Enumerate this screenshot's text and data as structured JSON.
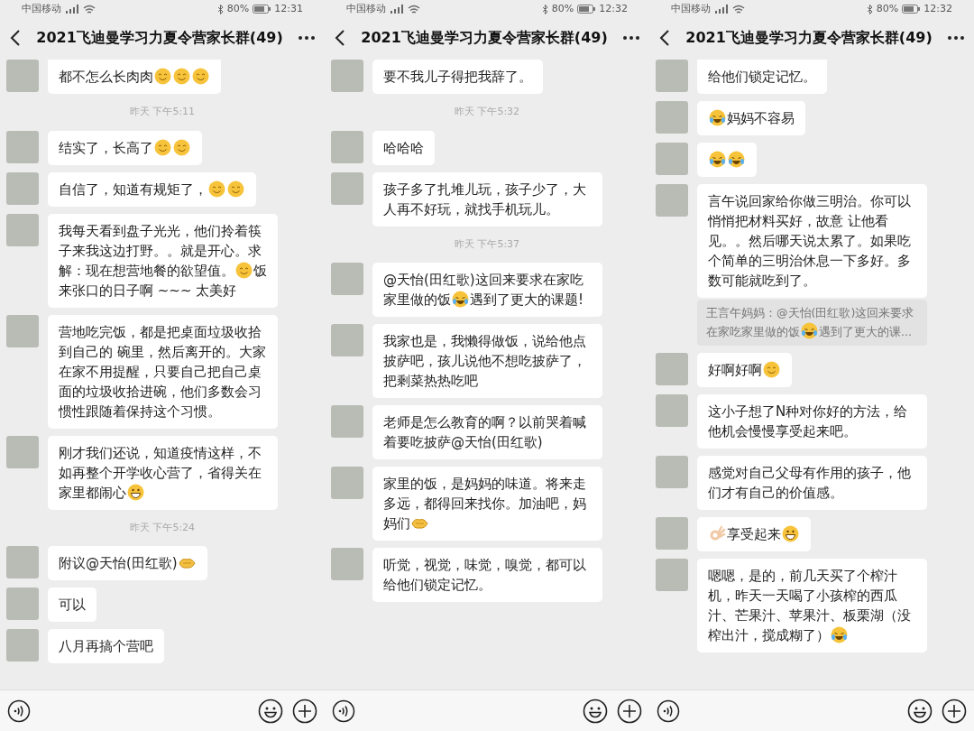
{
  "panels": [
    {
      "status_bar": {
        "carrier": "中国移动",
        "battery": "80%",
        "time": "12:31"
      },
      "title": "2021飞迪曼学习力夏令营家长群(49)",
      "messages": [
        {
          "kind": "msg",
          "cut": true,
          "parts": [
            {
              "kind": "text",
              "text": "都不怎么长肉肉"
            },
            {
              "kind": "smile"
            },
            {
              "kind": "smile"
            },
            {
              "kind": "smile"
            }
          ]
        },
        {
          "kind": "time",
          "text": "昨天 下午5:11"
        },
        {
          "kind": "msg",
          "parts": [
            {
              "kind": "text",
              "text": "结实了，长高了"
            },
            {
              "kind": "smile"
            },
            {
              "kind": "smile"
            }
          ]
        },
        {
          "kind": "msg",
          "parts": [
            {
              "kind": "text",
              "text": "自信了，知道有规矩了，"
            },
            {
              "kind": "smile"
            },
            {
              "kind": "smile"
            }
          ]
        },
        {
          "kind": "msg",
          "parts": [
            {
              "kind": "text",
              "text": "我每天看到盘子光光，他们拎着筷子来我这边打野。。就是开心。求解：现在想营地餐的欲望值。"
            },
            {
              "kind": "smile"
            },
            {
              "kind": "text",
              "text": "饭来张口的日子啊 ~~~ 太美好"
            }
          ]
        },
        {
          "kind": "msg",
          "parts": [
            {
              "kind": "text",
              "text": "营地吃完饭，都是把桌面垃圾收拾到自己的 碗里，然后离开的。大家在家不用提醒，只要自己把自己桌面的垃圾收拾进碗，他们多数会习惯性跟随着保持这个习惯。"
            }
          ]
        },
        {
          "kind": "msg",
          "parts": [
            {
              "kind": "text",
              "text": "刚才我们还说，知道疫情这样，不如再整个开学收心营了，省得关在家里都闹心"
            },
            {
              "kind": "grin"
            }
          ]
        },
        {
          "kind": "time",
          "text": "昨天 下午5:24"
        },
        {
          "kind": "msg",
          "parts": [
            {
              "kind": "text",
              "text": "附议@天怡(田红歌)"
            },
            {
              "kind": "handshake"
            }
          ]
        },
        {
          "kind": "msg",
          "parts": [
            {
              "kind": "text",
              "text": "可以"
            }
          ]
        },
        {
          "kind": "msg",
          "parts": [
            {
              "kind": "text",
              "text": "八月再搞个营吧"
            }
          ]
        }
      ]
    },
    {
      "status_bar": {
        "carrier": "中国移动",
        "battery": "80%",
        "time": "12:32"
      },
      "title": "2021飞迪曼学习力夏令营家长群(49)",
      "messages": [
        {
          "kind": "msg",
          "parts": [
            {
              "kind": "text",
              "text": "要不我儿子得把我辞了。"
            }
          ]
        },
        {
          "kind": "time",
          "text": "昨天 下午5:32"
        },
        {
          "kind": "msg",
          "parts": [
            {
              "kind": "text",
              "text": "哈哈哈"
            }
          ]
        },
        {
          "kind": "msg",
          "parts": [
            {
              "kind": "text",
              "text": "孩子多了扎堆儿玩，孩子少了，大人再不好玩，就找手机玩儿。"
            }
          ]
        },
        {
          "kind": "time",
          "text": "昨天 下午5:37"
        },
        {
          "kind": "msg",
          "parts": [
            {
              "kind": "text",
              "text": "@天怡(田红歌)这回来要求在家吃家里做的饭"
            },
            {
              "kind": "laugh-cry"
            },
            {
              "kind": "text",
              "text": "遇到了更大的课题!"
            }
          ]
        },
        {
          "kind": "msg",
          "parts": [
            {
              "kind": "text",
              "text": "我家也是，我懒得做饭，说给他点披萨吧，孩儿说他不想吃披萨了，把剩菜热热吃吧"
            }
          ]
        },
        {
          "kind": "msg",
          "parts": [
            {
              "kind": "text",
              "text": "老师是怎么教育的啊？以前哭着喊着要吃披萨@天怡(田红歌)"
            }
          ]
        },
        {
          "kind": "msg",
          "parts": [
            {
              "kind": "text",
              "text": "家里的饭，是妈妈的味道。将来走多远，都得回来找你。加油吧，妈妈们"
            },
            {
              "kind": "handshake"
            }
          ]
        },
        {
          "kind": "msg",
          "parts": [
            {
              "kind": "text",
              "text": "听觉，视觉，味觉，嗅觉，都可以给他们锁定记忆。"
            }
          ]
        }
      ]
    },
    {
      "status_bar": {
        "carrier": "中国移动",
        "battery": "80%",
        "time": "12:32"
      },
      "title": "2021飞迪曼学习力夏令营家长群(49)",
      "messages": [
        {
          "kind": "msg",
          "cut": true,
          "parts": [
            {
              "kind": "text",
              "text": "给他们锁定记忆。"
            }
          ]
        },
        {
          "kind": "msg",
          "parts": [
            {
              "kind": "laugh-cry"
            },
            {
              "kind": "text",
              "text": "妈妈不容易"
            }
          ]
        },
        {
          "kind": "msg",
          "parts": [
            {
              "kind": "laugh-cry"
            },
            {
              "kind": "laugh-cry"
            }
          ]
        },
        {
          "kind": "msg",
          "parts": [
            {
              "kind": "text",
              "text": "言午说回家给你做三明治。你可以悄悄把材料买好，故意 让他看见。。然后哪天说太累了。如果吃个简单的三明治休息一下多好。多数可能就吃到了。"
            }
          ]
        },
        {
          "kind": "quote",
          "parts": [
            {
              "kind": "text",
              "text": "王言午妈妈：@天怡(田红歌)这回来要求在家吃家里做的饭"
            },
            {
              "kind": "laugh-cry"
            },
            {
              "kind": "text",
              "text": "遇到了更大的课..."
            }
          ]
        },
        {
          "kind": "msg",
          "parts": [
            {
              "kind": "text",
              "text": "好啊好啊"
            },
            {
              "kind": "smile"
            }
          ]
        },
        {
          "kind": "msg",
          "parts": [
            {
              "kind": "text",
              "text": "这小子想了N种对你好的方法，给他机会慢慢享受起来吧。"
            }
          ]
        },
        {
          "kind": "msg",
          "parts": [
            {
              "kind": "text",
              "text": "感觉对自己父母有作用的孩子，他们才有自己的价值感。"
            }
          ]
        },
        {
          "kind": "msg",
          "parts": [
            {
              "kind": "ok-hand"
            },
            {
              "kind": "text",
              "text": "享受起来"
            },
            {
              "kind": "grin"
            }
          ]
        },
        {
          "kind": "msg",
          "parts": [
            {
              "kind": "text",
              "text": "嗯嗯，是的，前几天买了个榨汁机，昨天一天喝了小孩榨的西瓜汁、芒果汁、苹果汁、板栗湖（没榨出汁，搅成糊了）"
            },
            {
              "kind": "laugh-cry"
            }
          ]
        }
      ]
    }
  ]
}
